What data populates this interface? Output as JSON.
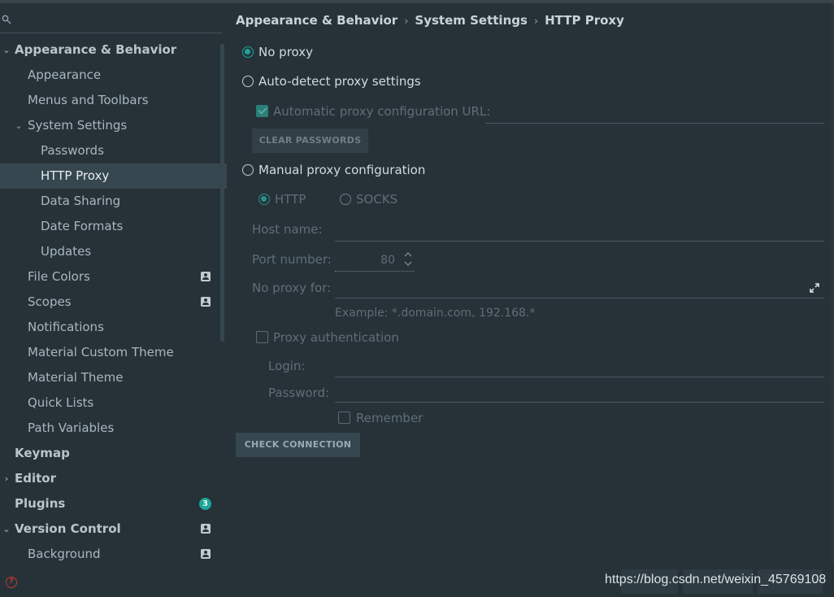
{
  "sidebar": {
    "items": [
      {
        "label": "Appearance & Behavior",
        "level": 0,
        "arrow": "⌄"
      },
      {
        "label": "Appearance",
        "level": 1
      },
      {
        "label": "Menus and Toolbars",
        "level": 1
      },
      {
        "label": "System Settings",
        "level": 1,
        "arrow": "⌄"
      },
      {
        "label": "Passwords",
        "level": 2
      },
      {
        "label": "HTTP Proxy",
        "level": 2,
        "selected": true
      },
      {
        "label": "Data Sharing",
        "level": 2
      },
      {
        "label": "Date Formats",
        "level": 2
      },
      {
        "label": "Updates",
        "level": 2
      },
      {
        "label": "File Colors",
        "level": 1,
        "icon": "user-icon"
      },
      {
        "label": "Scopes",
        "level": 1,
        "icon": "user-icon"
      },
      {
        "label": "Notifications",
        "level": 1
      },
      {
        "label": "Material Custom Theme",
        "level": 1
      },
      {
        "label": "Material Theme",
        "level": 1
      },
      {
        "label": "Quick Lists",
        "level": 1
      },
      {
        "label": "Path Variables",
        "level": 1
      },
      {
        "label": "Keymap",
        "level": 0
      },
      {
        "label": "Editor",
        "level": 0,
        "arrow": "›"
      },
      {
        "label": "Plugins",
        "level": 0,
        "badge": "3"
      },
      {
        "label": "Version Control",
        "level": 0,
        "arrow": "⌄",
        "icon": "user-icon"
      },
      {
        "label": "Background",
        "level": 1,
        "icon": "user-icon"
      }
    ]
  },
  "breadcrumb": {
    "part1": "Appearance & Behavior",
    "part2": "System Settings",
    "part3": "HTTP Proxy",
    "separator": "›"
  },
  "proxy": {
    "no_proxy": "No proxy",
    "auto_detect": "Auto-detect proxy settings",
    "auto_config_url": "Automatic proxy configuration URL:",
    "clear_passwords": "CLEAR PASSWORDS",
    "manual": "Manual proxy configuration",
    "http": "HTTP",
    "socks": "SOCKS",
    "host_name": "Host name:",
    "port_number": "Port number:",
    "port_value": "80",
    "no_proxy_for": "No proxy for:",
    "example": "Example: *.domain.com, 192.168.*",
    "proxy_auth": "Proxy authentication",
    "login": "Login:",
    "password": "Password:",
    "remember": "Remember",
    "check_connection": "CHECK CONNECTION",
    "selected_mode": "No proxy"
  },
  "footer": {
    "watermark": "https://blog.csdn.net/weixin_45769108"
  },
  "colors": {
    "background": "#263238",
    "selection": "#37474f",
    "accent": "#1da699"
  }
}
